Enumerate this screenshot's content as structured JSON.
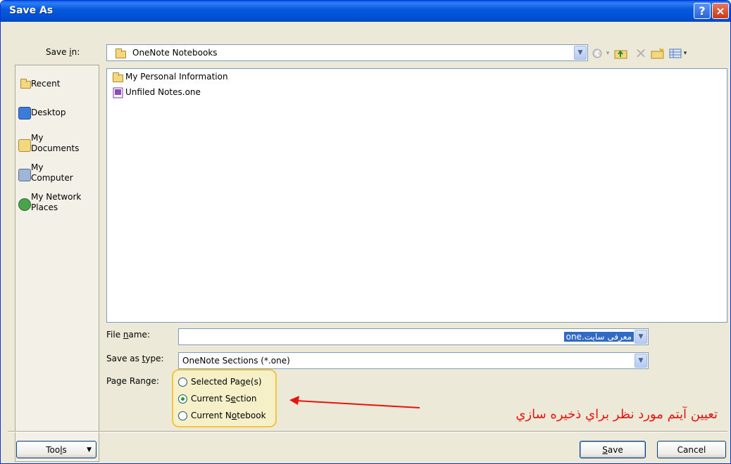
{
  "window": {
    "title": "Save As",
    "help_label": "?",
    "close_label": "×"
  },
  "save_in": {
    "label_pre": "Save ",
    "label_key": "i",
    "label_post": "n:",
    "value": "OneNote Notebooks"
  },
  "toolbar": {
    "icons": [
      "back-icon",
      "up-folder-icon",
      "delete-icon",
      "new-folder-icon",
      "views-icon"
    ]
  },
  "places": [
    {
      "label": "Recent",
      "icon": "recent-folder-icon"
    },
    {
      "label": "Desktop",
      "icon": "desktop-icon"
    },
    {
      "label_line1": "My",
      "label_line2": "Documents",
      "icon": "my-documents-icon"
    },
    {
      "label_line1": "My",
      "label_line2": "Computer",
      "icon": "my-computer-icon"
    },
    {
      "label_line1": "My Network",
      "label_line2": "Places",
      "icon": "network-places-icon"
    }
  ],
  "files": [
    {
      "name": "My Personal Information",
      "icon": "folder-icon"
    },
    {
      "name": "Unfiled Notes.one",
      "icon": "onenote-file-icon"
    }
  ],
  "file_name": {
    "label_pre": "File ",
    "label_key": "n",
    "label_post": "ame:",
    "value": "معرفی سایت.one"
  },
  "save_as_type": {
    "label_pre": "Save as ",
    "label_key": "t",
    "label_post": "ype:",
    "value": "OneNote Sections (*.one)"
  },
  "page_range": {
    "label": "Page Range:",
    "options": [
      {
        "pre": "Selected Pa",
        "key": "g",
        "post": "e(s)",
        "checked": false
      },
      {
        "pre": "Current S",
        "key": "e",
        "post": "ction",
        "checked": true
      },
      {
        "pre": "Current N",
        "key": "o",
        "post": "tebook",
        "checked": false
      }
    ]
  },
  "buttons": {
    "tools_pre": "Too",
    "tools_key": "l",
    "tools_post": "s",
    "save_key": "S",
    "save_post": "ave",
    "cancel": "Cancel"
  },
  "annotation": {
    "text": "تعیین آیتم مورد نظر براي ذخیره سازي",
    "color": "#e8140c"
  }
}
